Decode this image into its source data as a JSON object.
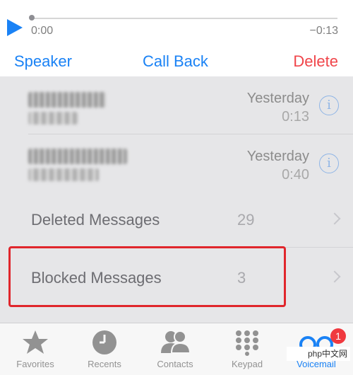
{
  "playback": {
    "time_elapsed": "0:00",
    "time_remaining": "−0:13",
    "progress": 0
  },
  "actions": {
    "speaker": "Speaker",
    "call_back": "Call Back",
    "delete": "Delete"
  },
  "voicemails": [
    {
      "date": "Yesterday",
      "duration": "0:13"
    },
    {
      "date": "Yesterday",
      "duration": "0:40"
    }
  ],
  "folders": [
    {
      "label": "Deleted Messages",
      "count": "29"
    },
    {
      "label": "Blocked Messages",
      "count": "3"
    }
  ],
  "tabbar": {
    "items": [
      {
        "label": "Favorites",
        "icon": "star-icon"
      },
      {
        "label": "Recents",
        "icon": "clock-icon"
      },
      {
        "label": "Contacts",
        "icon": "contacts-icon"
      },
      {
        "label": "Keypad",
        "icon": "keypad-icon"
      },
      {
        "label": "Voicemail",
        "icon": "voicemail-icon"
      }
    ],
    "voicemail_badge": "1"
  },
  "watermark": "php中文网",
  "colors": {
    "accent": "#1a82f5",
    "destructive": "#f0454a",
    "highlight": "#e0262c",
    "badge": "#f0393f"
  }
}
